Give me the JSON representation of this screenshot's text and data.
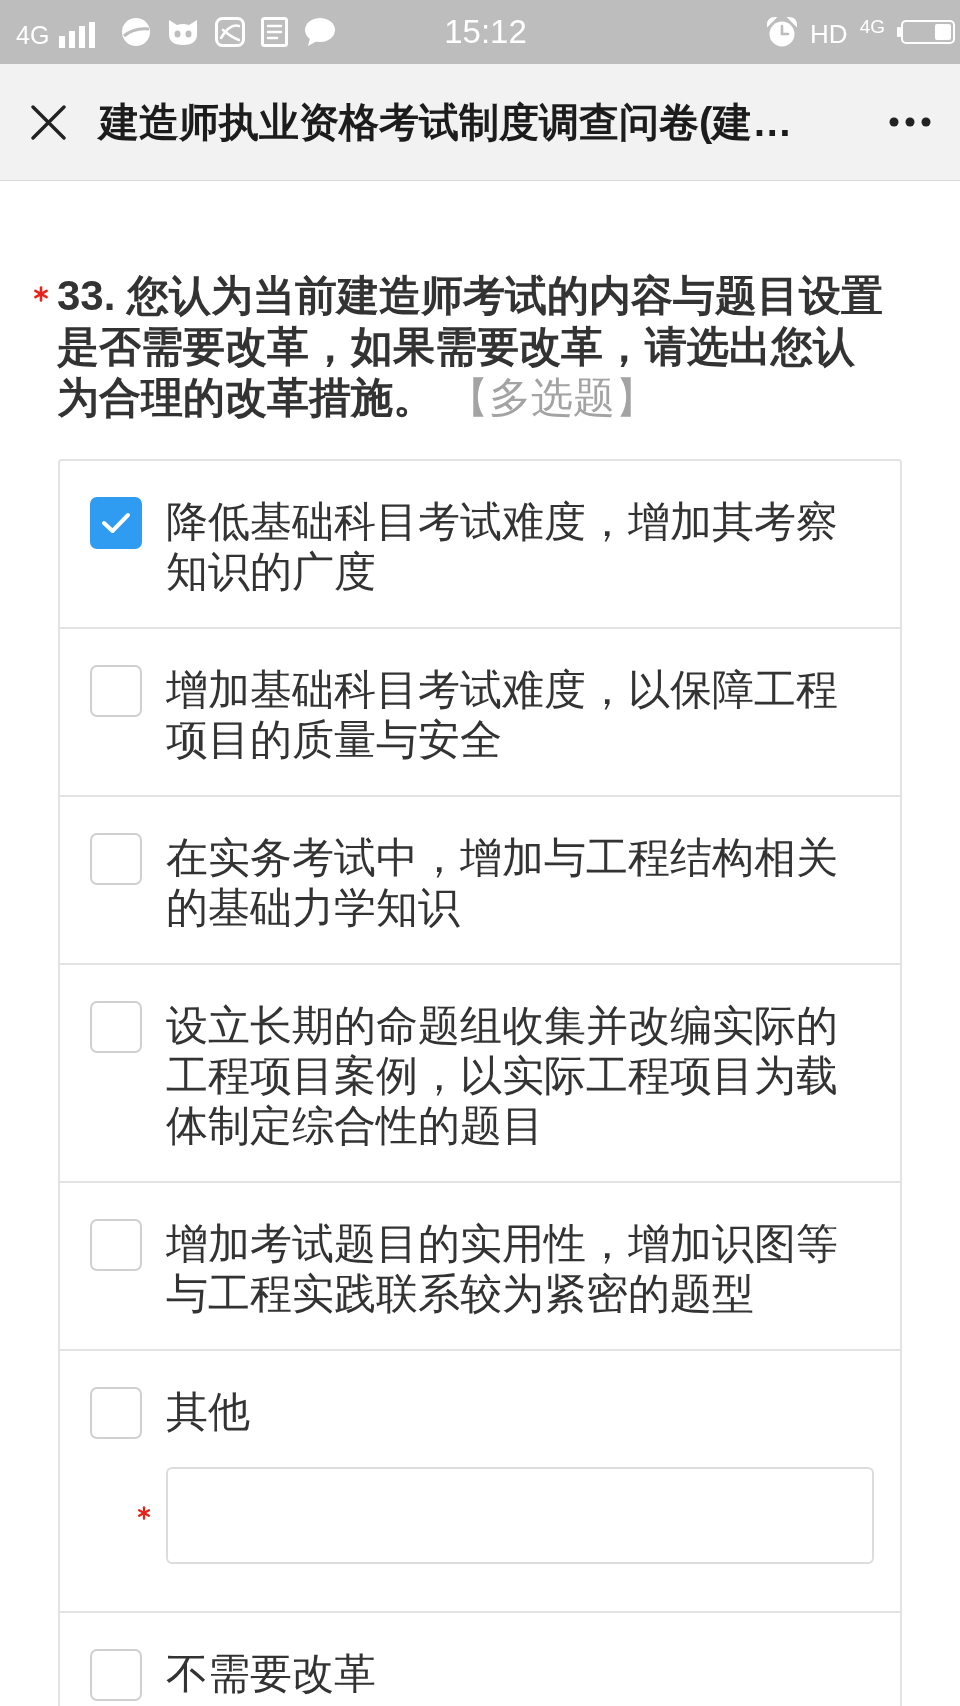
{
  "status_bar": {
    "network_left": "4G",
    "time": "15:12",
    "hd": "HD",
    "network_right": "4G"
  },
  "title_bar": {
    "title": "建造师执业资格考试制度调查问卷(建…"
  },
  "question": {
    "required": true,
    "text": "**33. 您认为当前建造师考试的内容与题目设置是否需要改革，如果需要改革，请选出您认为合理的改革措施。** 【多选题】"
  },
  "options": [
    {
      "kind": "plain",
      "label": "降低基础科目考试难度，增加其考察知识的广度",
      "checked": true
    },
    {
      "kind": "plain",
      "label": "增加基础科目考试难度，以保障工程项目的质量与安全",
      "checked": false
    },
    {
      "kind": "plain",
      "label": "在实务考试中，增加与工程结构相关的基础力学知识",
      "checked": false
    },
    {
      "kind": "plain",
      "label": "设立长期的命题组收集并改编实际的工程项目案例，以实际工程项目为载体制定综合性的题目",
      "checked": false
    },
    {
      "kind": "plain",
      "label": "增加考试题目的实用性，增加识图等与工程实践联系较为紧密的题型",
      "checked": false
    },
    {
      "kind": "with_input",
      "label": "其他",
      "checked": false,
      "input": {
        "required": true
      }
    },
    {
      "kind": "plain",
      "label": "不需要改革",
      "checked": false
    }
  ]
}
